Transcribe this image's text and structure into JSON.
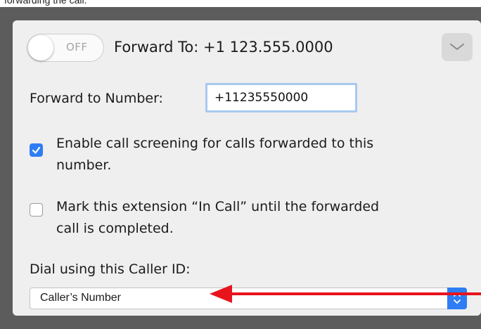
{
  "caption": "forwarding the call.",
  "header": {
    "toggle_state": "OFF",
    "forward_title": "Forward To: +1 123.555.0000",
    "expand_icon": "chevron-down-icon"
  },
  "form": {
    "number_label": "Forward to Number:",
    "number_value": "+11235550000",
    "screening": {
      "checked": true,
      "line1": "Enable call screening for calls forwarded to this",
      "line2": "number."
    },
    "mark_in_call": {
      "checked": false,
      "line1": "Mark this extension “In Call” until the forwarded",
      "line2": "call is completed."
    },
    "caller_id_label": "Dial using this Caller ID:",
    "caller_id_value": "Caller’s Number"
  },
  "annotation": {
    "arrow_color": "#e8141c"
  },
  "colors": {
    "accent": "#2f7df5",
    "input_focus": "#a8c9ef"
  }
}
